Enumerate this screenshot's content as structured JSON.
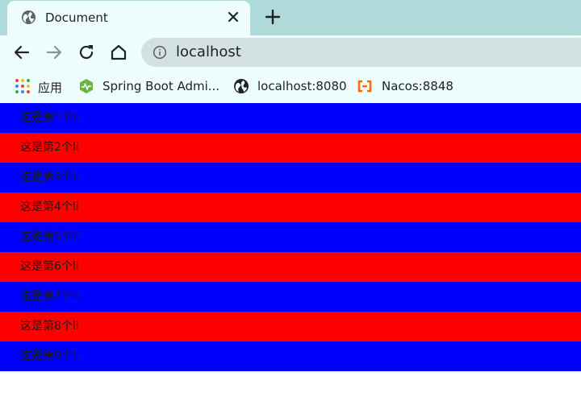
{
  "browser": {
    "tab": {
      "title": "Document",
      "favicon": "globe-icon",
      "close": "close-icon"
    },
    "new_tab": "plus-icon",
    "toolbar": {
      "back": "back-arrow-icon",
      "forward": "forward-arrow-icon",
      "reload": "reload-icon",
      "home": "home-icon"
    },
    "omnibox": {
      "info": "info-icon",
      "url": "localhost"
    },
    "bookmarks": [
      {
        "label": "应用",
        "icon": "apps-grid-icon"
      },
      {
        "label": "Spring Boot Admi...",
        "icon": "spring-boot-admin-icon"
      },
      {
        "label": "localhost:8080",
        "icon": "globe-icon"
      },
      {
        "label": "Nacos:8848",
        "icon": "nacos-icon"
      }
    ]
  },
  "page": {
    "list": [
      {
        "text": "这是第1个li",
        "color": "#0000ff"
      },
      {
        "text": "这是第2个li",
        "color": "#ff0000"
      },
      {
        "text": "这是第3个li",
        "color": "#0000ff"
      },
      {
        "text": "这是第4个li",
        "color": "#ff0000"
      },
      {
        "text": "这是第5个li",
        "color": "#0000ff"
      },
      {
        "text": "这是第6个li",
        "color": "#ff0000"
      },
      {
        "text": "这是第7个li",
        "color": "#0000ff"
      },
      {
        "text": "这是第8个li",
        "color": "#ff0000"
      },
      {
        "text": "这是第9个li",
        "color": "#0000ff"
      }
    ]
  },
  "colors": {
    "tabstrip": "#aedbd9",
    "toolbar": "#eefefc",
    "omnibox": "#d3e1e1",
    "odd_row": "#0000ff",
    "even_row": "#ff0000"
  }
}
